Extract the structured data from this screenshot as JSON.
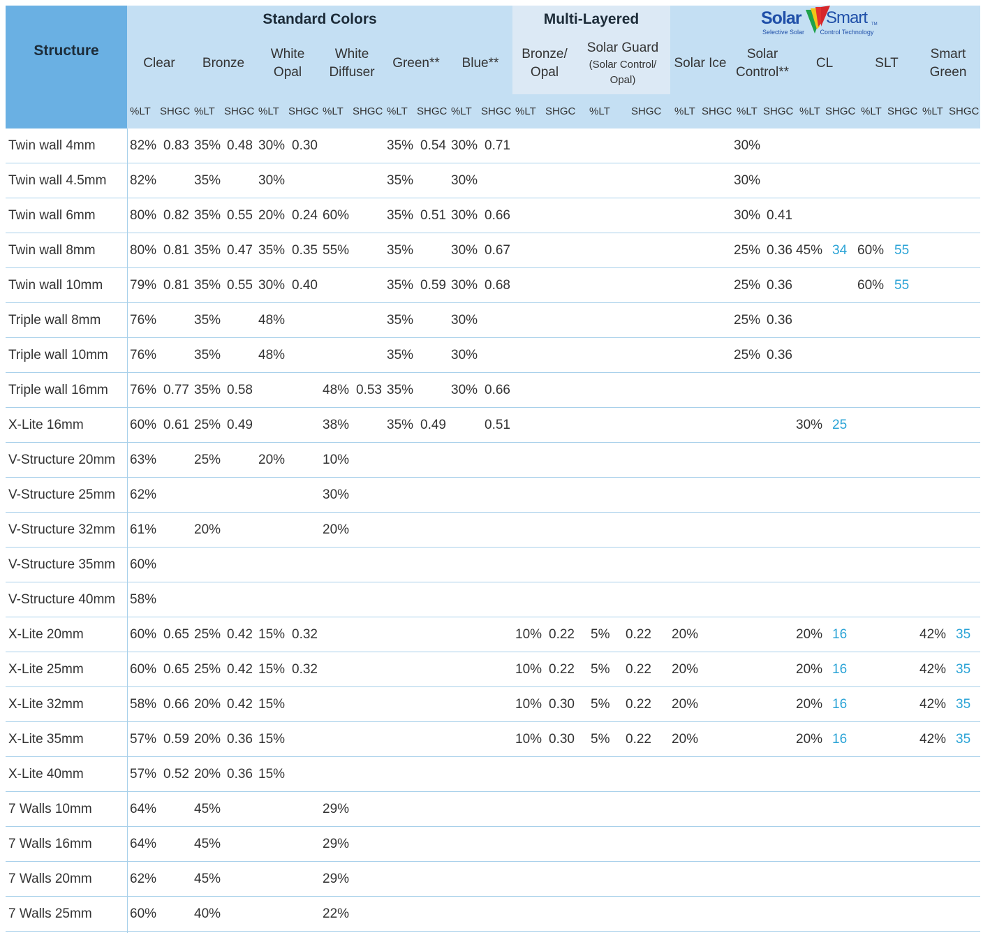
{
  "header": {
    "structure": "Structure",
    "group_standard": "Standard Colors",
    "group_multilayer": "Multi-Layered",
    "logo": {
      "solar": "Solar",
      "smart": "Smart",
      "tm": "TM",
      "tagline_left": "Selective Solar",
      "tagline_right": "Control Technology"
    },
    "columns": [
      {
        "title": "Clear"
      },
      {
        "title": "Bronze"
      },
      {
        "title": "White\nOpal"
      },
      {
        "title": "White\nDiffuser"
      },
      {
        "title": "Green**"
      },
      {
        "title": "Blue**"
      },
      {
        "title": "Bronze/\nOpal"
      },
      {
        "title": "Solar Guard",
        "subtitle": "(Solar Control/\nOpal)"
      },
      {
        "title": "Solar Ice"
      },
      {
        "title": "Solar\nControl**"
      },
      {
        "title": "CL"
      },
      {
        "title": "SLT"
      },
      {
        "title": "Smart\nGreen"
      }
    ],
    "sub_lt": "%LT",
    "sub_shgc": "SHGC"
  },
  "rows": [
    {
      "name": "Twin wall 4mm",
      "cells": [
        "82%",
        "0.83",
        "35%",
        "0.48",
        "30%",
        "0.30",
        "",
        "",
        "35%",
        "0.54",
        "30%",
        "0.71",
        "",
        "",
        "",
        "",
        "",
        "",
        "30%",
        "",
        "",
        "",
        "",
        "",
        "",
        ""
      ]
    },
    {
      "name": "Twin wall 4.5mm",
      "cells": [
        "82%",
        "",
        "35%",
        "",
        "30%",
        "",
        "",
        "",
        "35%",
        "",
        "30%",
        "",
        "",
        "",
        "",
        "",
        "",
        "",
        "30%",
        "",
        "",
        "",
        "",
        "",
        "",
        ""
      ]
    },
    {
      "name": "Twin wall 6mm",
      "cells": [
        "80%",
        "0.82",
        "35%",
        "0.55",
        "20%",
        "0.24",
        "60%",
        "",
        "35%",
        "0.51",
        "30%",
        "0.66",
        "",
        "",
        "",
        "",
        "",
        "",
        "30%",
        "0.41",
        "",
        "",
        "",
        "",
        "",
        ""
      ]
    },
    {
      "name": "Twin wall 8mm",
      "cells": [
        "80%",
        "0.81",
        "35%",
        "0.47",
        "35%",
        "0.35",
        "55%",
        "",
        "35%",
        "",
        "30%",
        "0.67",
        "",
        "",
        "",
        "",
        "",
        "",
        "25%",
        "0.36",
        "45%",
        "34",
        "60%",
        "55",
        "",
        ""
      ]
    },
    {
      "name": "Twin wall 10mm",
      "cells": [
        "79%",
        "0.81",
        "35%",
        "0.55",
        "30%",
        "0.40",
        "",
        "",
        "35%",
        "0.59",
        "30%",
        "0.68",
        "",
        "",
        "",
        "",
        "",
        "",
        "25%",
        "0.36",
        "",
        "",
        "60%",
        "55",
        "",
        ""
      ]
    },
    {
      "name": "Triple wall 8mm",
      "cells": [
        "76%",
        "",
        "35%",
        "",
        "48%",
        "",
        "",
        "",
        "35%",
        "",
        "30%",
        "",
        "",
        "",
        "",
        "",
        "",
        "",
        "25%",
        "0.36",
        "",
        "",
        "",
        "",
        "",
        ""
      ]
    },
    {
      "name": "Triple wall 10mm",
      "cells": [
        "76%",
        "",
        "35%",
        "",
        "48%",
        "",
        "",
        "",
        "35%",
        "",
        "30%",
        "",
        "",
        "",
        "",
        "",
        "",
        "",
        "25%",
        "0.36",
        "",
        "",
        "",
        "",
        "",
        ""
      ]
    },
    {
      "name": "Triple wall 16mm",
      "cells": [
        "76%",
        "0.77",
        "35%",
        "0.58",
        "",
        "",
        "48%",
        "0.53",
        "35%",
        "",
        "30%",
        "0.66",
        "",
        "",
        "",
        "",
        "",
        "",
        "",
        "",
        "",
        "",
        "",
        "",
        "",
        ""
      ]
    },
    {
      "name": "X-Lite 16mm",
      "cells": [
        "60%",
        "0.61",
        "25%",
        "0.49",
        "",
        "",
        "38%",
        "",
        "35%",
        "0.49",
        "",
        "0.51",
        "",
        "",
        "",
        "",
        "",
        "",
        "",
        "",
        "30%",
        "25",
        "",
        "",
        "",
        ""
      ]
    },
    {
      "name": "V-Structure 20mm",
      "cells": [
        "63%",
        "",
        "25%",
        "",
        "20%",
        "",
        "10%",
        "",
        "",
        "",
        "",
        "",
        "",
        "",
        "",
        "",
        "",
        "",
        "",
        "",
        "",
        "",
        "",
        "",
        "",
        ""
      ]
    },
    {
      "name": "V-Structure 25mm",
      "cells": [
        "62%",
        "",
        "",
        "",
        "",
        "",
        "30%",
        "",
        "",
        "",
        "",
        "",
        "",
        "",
        "",
        "",
        "",
        "",
        "",
        "",
        "",
        "",
        "",
        "",
        "",
        ""
      ]
    },
    {
      "name": "V-Structure 32mm",
      "cells": [
        "61%",
        "",
        "20%",
        "",
        "",
        "",
        "20%",
        "",
        "",
        "",
        "",
        "",
        "",
        "",
        "",
        "",
        "",
        "",
        "",
        "",
        "",
        "",
        "",
        "",
        "",
        ""
      ]
    },
    {
      "name": "V-Structure 35mm",
      "cells": [
        "60%",
        "",
        "",
        "",
        "",
        "",
        "",
        "",
        "",
        "",
        "",
        "",
        "",
        "",
        "",
        "",
        "",
        "",
        "",
        "",
        "",
        "",
        "",
        "",
        "",
        ""
      ]
    },
    {
      "name": "V-Structure 40mm",
      "cells": [
        "58%",
        "",
        "",
        "",
        "",
        "",
        "",
        "",
        "",
        "",
        "",
        "",
        "",
        "",
        "",
        "",
        "",
        "",
        "",
        "",
        "",
        "",
        "",
        "",
        "",
        ""
      ]
    },
    {
      "name": "X-Lite 20mm",
      "cells": [
        "60%",
        "0.65",
        "25%",
        "0.42",
        "15%",
        "0.32",
        "",
        "",
        "",
        "",
        "",
        "",
        "10%",
        "0.22",
        "5%",
        "0.22",
        "20%",
        "",
        "",
        "",
        "20%",
        "16",
        "",
        "",
        "42%",
        "35"
      ]
    },
    {
      "name": "X-Lite 25mm",
      "cells": [
        "60%",
        "0.65",
        "25%",
        "0.42",
        "15%",
        "0.32",
        "",
        "",
        "",
        "",
        "",
        "",
        "10%",
        "0.22",
        "5%",
        "0.22",
        "20%",
        "",
        "",
        "",
        "20%",
        "16",
        "",
        "",
        "42%",
        "35"
      ]
    },
    {
      "name": "X-Lite 32mm",
      "cells": [
        "58%",
        "0.66",
        "20%",
        "0.42",
        "15%",
        "",
        "",
        "",
        "",
        "",
        "",
        "",
        "10%",
        "0.30",
        "5%",
        "0.22",
        "20%",
        "",
        "",
        "",
        "20%",
        "16",
        "",
        "",
        "42%",
        "35"
      ]
    },
    {
      "name": "X-Lite 35mm",
      "cells": [
        "57%",
        "0.59",
        "20%",
        "0.36",
        "15%",
        "",
        "",
        "",
        "",
        "",
        "",
        "",
        "10%",
        "0.30",
        "5%",
        "0.22",
        "20%",
        "",
        "",
        "",
        "20%",
        "16",
        "",
        "",
        "42%",
        "35"
      ]
    },
    {
      "name": "X-Lite 40mm",
      "cells": [
        "57%",
        "0.52",
        "20%",
        "0.36",
        "15%",
        "",
        "",
        "",
        "",
        "",
        "",
        "",
        "",
        "",
        "",
        "",
        "",
        "",
        "",
        "",
        "",
        "",
        "",
        "",
        "",
        ""
      ]
    },
    {
      "name": "7 Walls 10mm",
      "cells": [
        "64%",
        "",
        "45%",
        "",
        "",
        "",
        "29%",
        "",
        "",
        "",
        "",
        "",
        "",
        "",
        "",
        "",
        "",
        "",
        "",
        "",
        "",
        "",
        "",
        "",
        "",
        ""
      ]
    },
    {
      "name": "7 Walls 16mm",
      "cells": [
        "64%",
        "",
        "45%",
        "",
        "",
        "",
        "29%",
        "",
        "",
        "",
        "",
        "",
        "",
        "",
        "",
        "",
        "",
        "",
        "",
        "",
        "",
        "",
        "",
        "",
        "",
        ""
      ]
    },
    {
      "name": "7 Walls 20mm",
      "cells": [
        "62%",
        "",
        "45%",
        "",
        "",
        "",
        "29%",
        "",
        "",
        "",
        "",
        "",
        "",
        "",
        "",
        "",
        "",
        "",
        "",
        "",
        "",
        "",
        "",
        "",
        "",
        ""
      ]
    },
    {
      "name": "7 Walls 25mm",
      "cells": [
        "60%",
        "",
        "40%",
        "",
        "",
        "",
        "22%",
        "",
        "",
        "",
        "",
        "",
        "",
        "",
        "",
        "",
        "",
        "",
        "",
        "",
        "",
        "",
        "",
        "",
        "",
        ""
      ]
    }
  ],
  "colors": {
    "structure_header_bg": "#6ab0e3",
    "header_bg": "#c4dff3",
    "multilayer_header_bg": "#dce9f5",
    "row_separator": "#a8d0ea",
    "highlight_value": "#2aa3d6",
    "logo_blue": "#1f4fa8"
  },
  "highlight_columns": [
    21,
    23,
    25
  ]
}
